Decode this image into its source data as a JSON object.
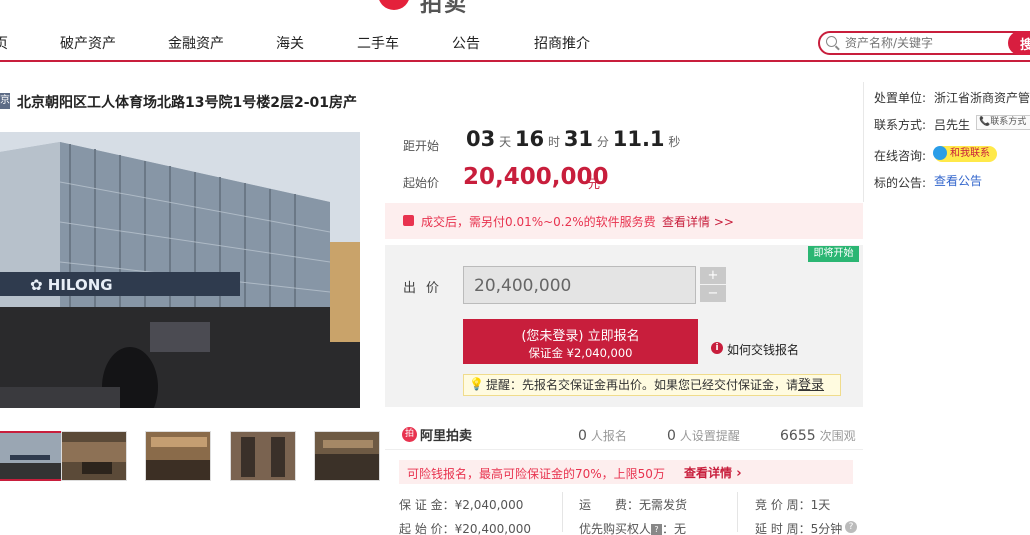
{
  "header": {
    "logo_text": "拍卖"
  },
  "nav": {
    "items": [
      "页",
      "破产资产",
      "金融资产",
      "海关",
      "二手车",
      "公告",
      "招商推介"
    ]
  },
  "search": {
    "placeholder": "资产名称/关键字",
    "button_glyph": "搜"
  },
  "item": {
    "tag": "京",
    "title": "北京朝阳区工人体育场北路13号院1号楼2层2-01房产"
  },
  "countdown": {
    "label": "距开始",
    "days": "03",
    "days_unit": "天",
    "hours": "16",
    "hours_unit": "时",
    "minutes": "31",
    "minutes_unit": "分",
    "seconds": "11.1",
    "seconds_unit": "秒"
  },
  "price": {
    "label": "起始价",
    "value": "20,400,000",
    "unit": "元"
  },
  "fee": {
    "text": "成交后，需另付0.01%~0.2%的软件服务费",
    "link": "查看详情 >>"
  },
  "bid": {
    "badge": "即将开始",
    "label": "出价",
    "value": "20,400,000",
    "step_up": "+",
    "step_down": "−",
    "register_line1": "(您未登录) 立即报名",
    "register_line2": "保证金 ¥2,040,000",
    "howto": "如何交钱报名",
    "tip_prefix": "提醒：先报名交保证金再出价。如果您已经交付保证金，请",
    "tip_link": "登录"
  },
  "stats": {
    "brand": "阿里拍卖",
    "signup_count": "0",
    "signup_label": "人报名",
    "remind_count": "0",
    "remind_label": "人设置提醒",
    "views_count": "6655",
    "views_label": "次围观"
  },
  "deposit": {
    "text": "可险钱报名，最高可险保证金的70%，上限50万",
    "link": "查看详情"
  },
  "details": {
    "deposit": "保 证 金：¥2,040,000",
    "start_price": "起 始 价：¥20,400,000",
    "shipping": "运　　费：无需发货",
    "priority": "优先购买权人",
    "priority_value": "：无",
    "cycle": "竞 价 周：1天",
    "delay": "延 时 周：5分钟"
  },
  "seller": {
    "unit_label": "处置单位:",
    "unit_value": "浙江省浙商资产管",
    "contact_label": "联系方式:",
    "contact_value": "吕先生",
    "contact_button": "联系方式",
    "consult_label": "在线咨询:",
    "consult_value": "和我联系",
    "notice_label": "标的公告:",
    "notice_link": "查看公告"
  },
  "colors": {
    "brand_red": "#c81e3c",
    "accent_green": "#2bb673"
  }
}
